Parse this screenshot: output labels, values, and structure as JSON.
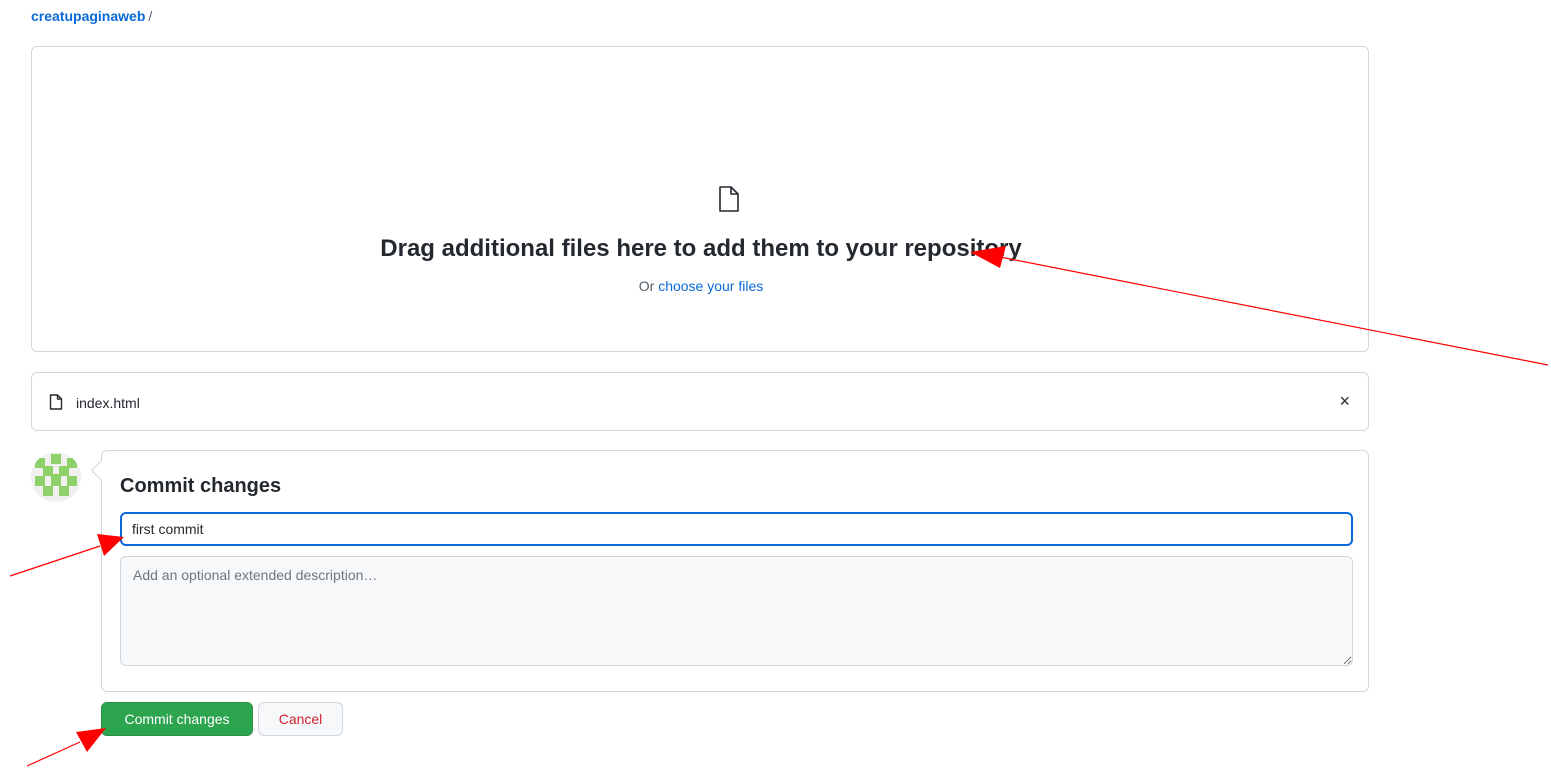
{
  "breadcrumb": {
    "repo": "creatupaginaweb",
    "separator": "/"
  },
  "dropzone": {
    "icon": "file-icon",
    "title": "Drag additional files here to add them to your repository",
    "sub_prefix": "Or",
    "choose_link": "choose your files"
  },
  "files": [
    {
      "name": "index.html",
      "icon": "file-icon",
      "remove": "×"
    }
  ],
  "commit": {
    "title": "Commit changes",
    "message_value": "first commit",
    "description_placeholder": "Add an optional extended description…",
    "commit_button": "Commit changes",
    "cancel_button": "Cancel"
  },
  "colors": {
    "link": "#0969da",
    "primary_button": "#2da44e",
    "cancel_text": "#cf222e",
    "annotation_arrow": "#ff0000"
  }
}
